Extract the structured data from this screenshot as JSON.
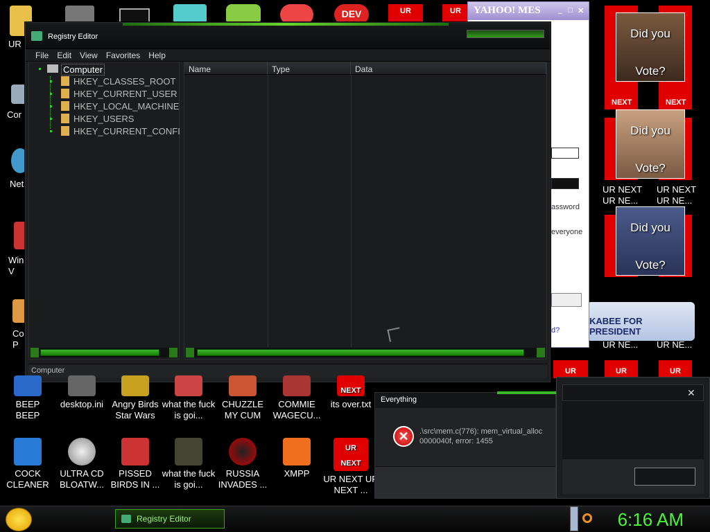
{
  "desktop": {
    "top_icons": [
      "UR",
      "Cor",
      "Net",
      "Win V",
      "Co P"
    ],
    "bottom_row1": [
      {
        "label": "BEEP BEEP"
      },
      {
        "label": "desktop.ini"
      },
      {
        "label": "Angry Birds Star Wars"
      },
      {
        "label": "what the fuck is goi..."
      },
      {
        "label": "CHUZZLE MY CUM"
      },
      {
        "label": "COMMIE WAGECU..."
      },
      {
        "label": "its over.txt"
      }
    ],
    "bottom_row2": [
      {
        "label": "COCK CLEANER"
      },
      {
        "label": "ULTRA CD BLOATW..."
      },
      {
        "label": "PISSED BIRDS IN ..."
      },
      {
        "label": "what the fuck is goi..."
      },
      {
        "label": "RUSSIA INVADES ..."
      },
      {
        "label": "XMPP"
      },
      {
        "label": "UR NEXT UR NEXT ..."
      }
    ],
    "ur_text": "UR",
    "next_text": "NEXT",
    "ur_next_text": "UR NEXT",
    "ur_ne_text": "UR NE...",
    "vote_line1": "Did you",
    "vote_line2": "Vote?",
    "president_banner": "KABEE FOR PRESIDENT"
  },
  "regedit": {
    "title": "Registry Editor",
    "menu": [
      "File",
      "Edit",
      "View",
      "Favorites",
      "Help"
    ],
    "tree_root": "Computer",
    "tree_items": [
      "HKEY_CLASSES_ROOT",
      "HKEY_CURRENT_USER",
      "HKEY_LOCAL_MACHINE",
      "HKEY_USERS",
      "HKEY_CURRENT_CONFI"
    ],
    "columns": [
      "Name",
      "Type",
      "Data"
    ],
    "status": "Computer"
  },
  "yahoo": {
    "title": "YAHOO! MES",
    "password_text": "assword",
    "everyone_text": "everyone",
    "link_text": "d?"
  },
  "everything": {
    "title": "Everything",
    "error_line1": ".\\src\\mem.c(776): mem_virtual_alloc",
    "error_line2": "0000040f, error: 1455"
  },
  "taskbar": {
    "task_label": "Registry Editor",
    "clock": "6:16 AM"
  },
  "colors": {
    "accent_green": "#4ff13d",
    "ur_red": "#e00000"
  }
}
